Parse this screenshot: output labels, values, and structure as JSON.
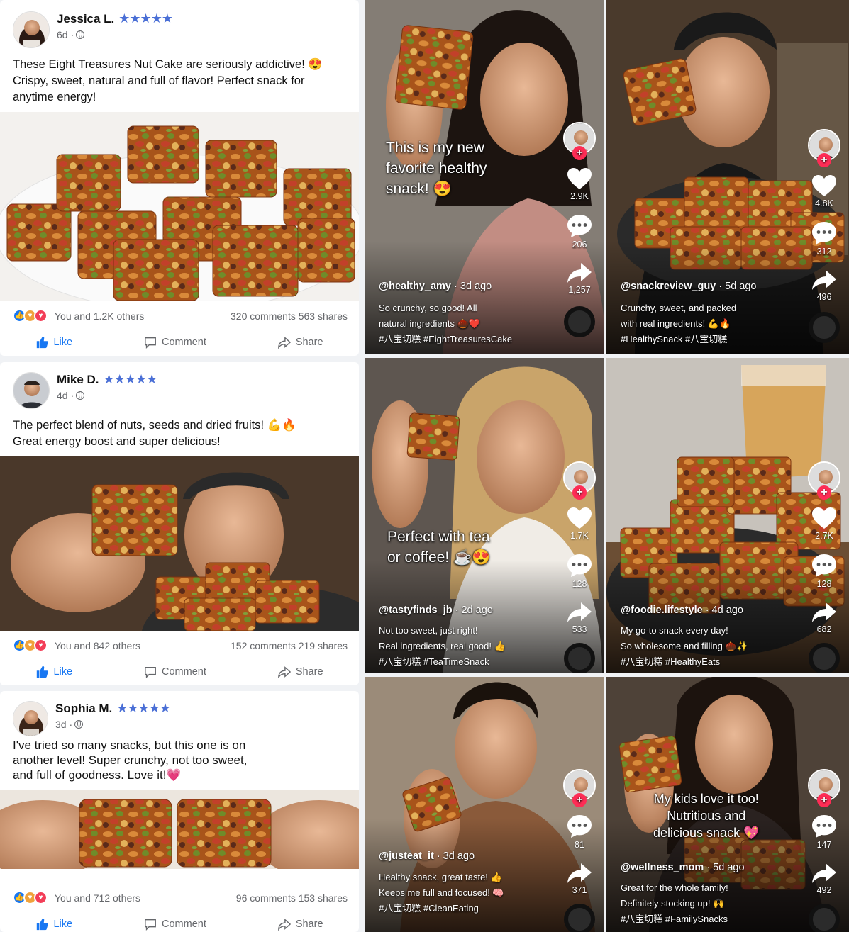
{
  "posts": [
    {
      "name": "Jessica L.",
      "stars": "★★★★★",
      "time": "6d ·",
      "text": "These Eight Treasures Nut Cake are seriously addictive! 😍\nCrispy, sweet, natural and full of flavor! Perfect snack for\nanytime energy!",
      "reactions": "You and 1.2K others",
      "counts": "320 comments 563 shares",
      "like": "Like",
      "comment": "Comment",
      "share": "Share"
    },
    {
      "name": "Mike D.",
      "stars": "★★★★★",
      "time": "4d ·",
      "text": "The perfect blend of nuts, seeds and dried fruits! 💪🔥\nGreat energy boost and super delicious!",
      "reactions": "You and 842 others",
      "counts": "152 comments 219 shares",
      "like": "Like",
      "comment": "Comment",
      "share": "Share"
    },
    {
      "name": "Sophia M.",
      "stars": "★★★★★",
      "time": "3d ·",
      "text": "I've tried so many snacks, but this one is on\nanother level! Super crunchy, not too sweet,\nand full of goodness. Love it!💗",
      "reactions": "You and 712 others",
      "counts": "96 comments 153 shares",
      "like": "Like",
      "comment": "Comment",
      "share": "Share"
    }
  ],
  "videos": [
    {
      "overlay": "This is my new\nfavorite healthy\nsnack! 😍",
      "user": "@healthy_amy",
      "ago": "· 3d ago",
      "desc": "So crunchy, so good! All\nnatural ingredients 🌰❤️\n#八宝切糕 #EightTreasuresCake",
      "likes": "2.9K",
      "comments": "206",
      "shares": "1,257"
    },
    {
      "overlay": "",
      "user": "@snackreview_guy",
      "ago": "· 5d ago",
      "desc": "Crunchy, sweet, and packed\nwith real ingredients! 💪🔥\n#HealthySnack #八宝切糕",
      "likes": "4.8K",
      "comments": "312",
      "shares": "496"
    },
    {
      "overlay": "Perfect with tea\nor coffee! ☕😍",
      "user": "@tastyfinds_jb",
      "ago": "· 2d ago",
      "desc": "Not too sweet, just right!\nReal ingredients, real good! 👍\n#八宝切糕 #TeaTimeSnack",
      "likes": "1.7K",
      "comments": "128",
      "shares": "533"
    },
    {
      "overlay": "",
      "user": "@foodie.lifestyle",
      "ago": "· 4d ago",
      "desc": "My go-to snack every day!\nSo wholesome and filling 🌰✨\n#八宝切糕 #HealthyEats",
      "likes": "2.7K",
      "comments": "128",
      "shares": "682"
    },
    {
      "overlay": "",
      "user": "@justeat_it",
      "ago": "· 3d ago",
      "desc": "Healthy snack, great taste! 👍\nKeeps me full and focused! 🧠\n#八宝切糕 #CleanEating",
      "likes": "",
      "comments": "81",
      "shares": "371"
    },
    {
      "overlay": "My kids love it too!\nNutritious and\ndelicious snack 💖",
      "user": "@wellness_mom",
      "ago": "· 5d ago",
      "desc": "Great for the whole family!\nDefinitely stocking up! 🙌\n#八宝切糕 #FamilySnacks",
      "likes": "",
      "comments": "147",
      "shares": "492"
    }
  ],
  "colors": {
    "fb_blue": "#1877f2",
    "star_blue": "#4a6fd6",
    "tiktok_red": "#fe2c55"
  },
  "icons": [
    "heart-icon",
    "comment-bubble-icon",
    "share-arrow-icon",
    "thumbs-up-icon",
    "globe-icon",
    "music-disc-icon"
  ]
}
